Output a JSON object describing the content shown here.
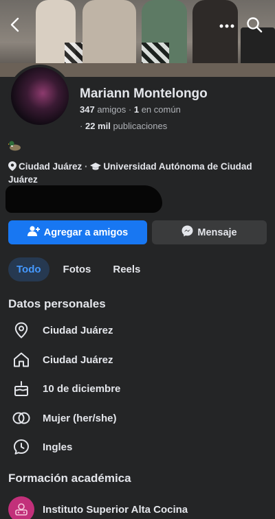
{
  "header": {
    "back_icon": "chevron-left-icon",
    "more_icon": "more-horizontal-icon",
    "search_icon": "search-icon"
  },
  "profile": {
    "name": "Mariann Montelongo",
    "friends_count": "347",
    "friends_label": "amigos",
    "mutual_count": "1",
    "mutual_label": "en común",
    "posts_count": "22 mil",
    "posts_label": "publicaciones",
    "city": "Ciudad Juárez",
    "separator": "·",
    "university": "Universidad Autónoma de Ciudad Juárez"
  },
  "actions": {
    "add_friend": "Agregar a amigos",
    "message": "Mensaje"
  },
  "tabs": [
    {
      "label": "Todo",
      "active": true
    },
    {
      "label": "Fotos",
      "active": false
    },
    {
      "label": "Reels",
      "active": false
    }
  ],
  "personal": {
    "title": "Datos personales",
    "items": [
      {
        "icon": "location-pin-icon",
        "text": "Ciudad Juárez"
      },
      {
        "icon": "home-icon",
        "text": "Ciudad Juárez"
      },
      {
        "icon": "birthday-cake-icon",
        "text": "10 de diciembre"
      },
      {
        "icon": "gender-rings-icon",
        "text": "Mujer (her/she)"
      },
      {
        "icon": "language-bubble-icon",
        "text": "Ingles"
      }
    ]
  },
  "education": {
    "title": "Formación académica",
    "school": "Instituto Superior Alta Cocina"
  },
  "colors": {
    "background": "#242526",
    "primary_button": "#1877f2",
    "secondary_button": "#3a3b3c",
    "active_tab_bg": "#263951",
    "active_tab_text": "#4599ff"
  }
}
